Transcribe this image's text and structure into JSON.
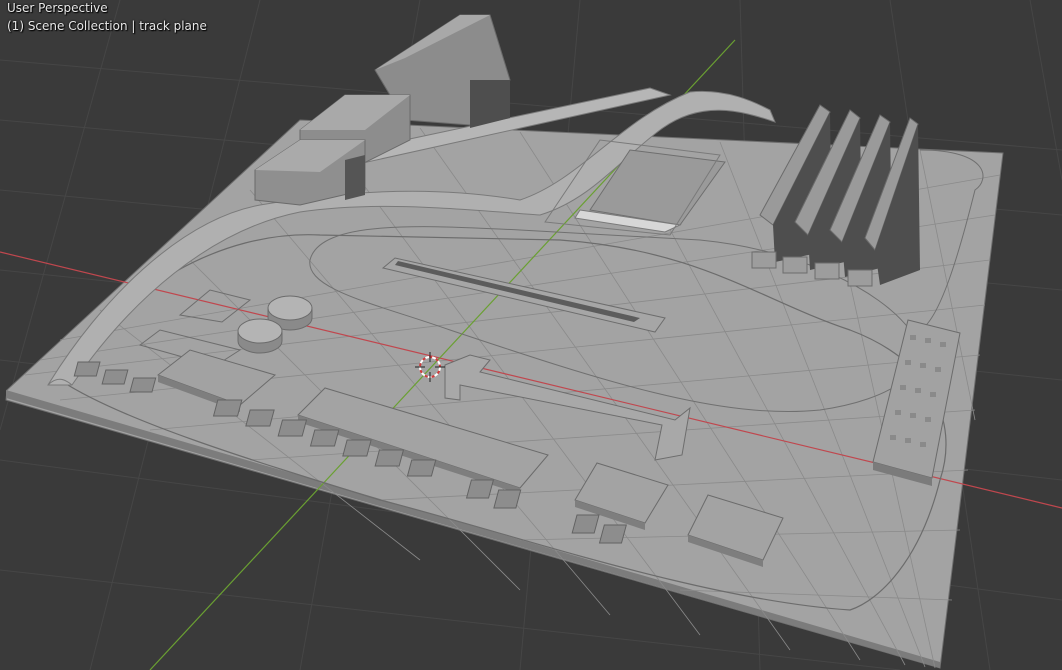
{
  "viewport": {
    "view_name": "User Perspective",
    "collection_label": "(1) Scene Collection | track plane",
    "background_color": "#3a3a3a",
    "grid_color": "#4a4a4a",
    "x_axis_color": "#c0474e",
    "y_axis_color": "#6aa032",
    "model_color": "#9d9d9d",
    "icons": {
      "origin": "3d-cursor-icon"
    }
  }
}
